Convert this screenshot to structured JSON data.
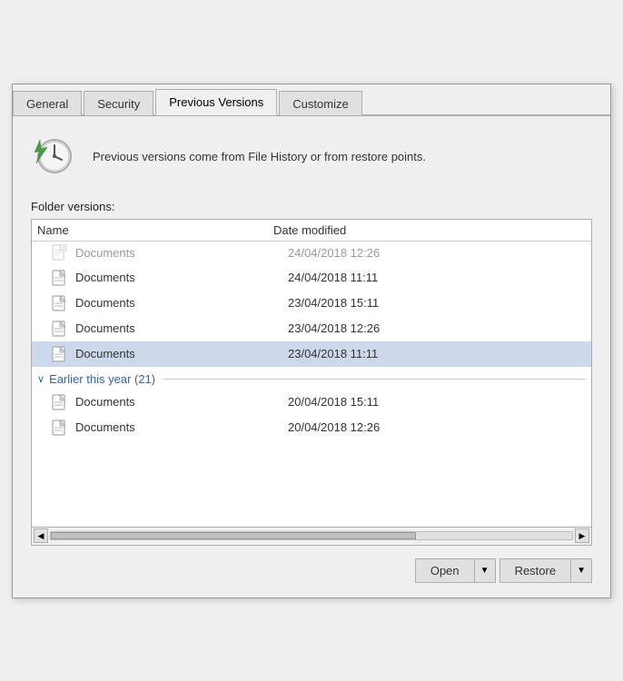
{
  "tabs": [
    {
      "id": "general",
      "label": "General",
      "active": false
    },
    {
      "id": "security",
      "label": "Security",
      "active": false
    },
    {
      "id": "previous-versions",
      "label": "Previous Versions",
      "active": true
    },
    {
      "id": "customize",
      "label": "Customize",
      "active": false
    }
  ],
  "info": {
    "text": "Previous versions come from File History or from restore points."
  },
  "section_label": "Folder versions:",
  "columns": {
    "name": "Name",
    "date_modified": "Date modified"
  },
  "rows_truncated": [
    {
      "id": "row-t1",
      "name": "Documents",
      "date": "24/04/2018 12:26",
      "truncated": true
    }
  ],
  "rows_today": [
    {
      "id": "row-1",
      "name": "Documents",
      "date": "24/04/2018 11:11"
    },
    {
      "id": "row-2",
      "name": "Documents",
      "date": "23/04/2018 15:11"
    },
    {
      "id": "row-3",
      "name": "Documents",
      "date": "23/04/2018 12:26"
    },
    {
      "id": "row-4",
      "name": "Documents",
      "date": "23/04/2018 11:11",
      "selected": true
    }
  ],
  "group_earlier": {
    "label": "Earlier this year (21)"
  },
  "rows_earlier": [
    {
      "id": "row-e1",
      "name": "Documents",
      "date": "20/04/2018 15:11"
    },
    {
      "id": "row-e2",
      "name": "Documents",
      "date": "20/04/2018 12:26"
    }
  ],
  "buttons": {
    "open": "Open",
    "restore": "Restore"
  }
}
